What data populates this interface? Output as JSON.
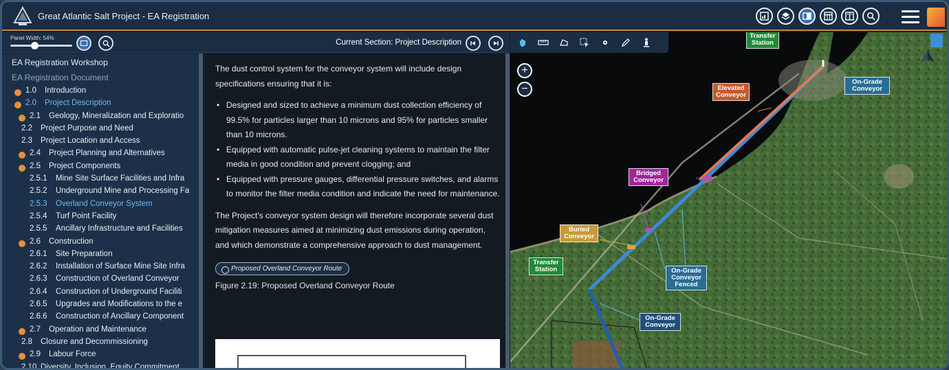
{
  "app": {
    "title": "Great Atlantic Salt Project - EA Registration"
  },
  "toolbar_icons": [
    "chart-icon",
    "layers-icon",
    "document-icon",
    "table-icon",
    "book-icon",
    "search-icon"
  ],
  "left_toolbar": {
    "panel_width_label": "Panel Width: 54%",
    "panel_width_percent": 54,
    "current_section": "Current Section: Project Description"
  },
  "toc": {
    "heading": "EA Registration Workshop",
    "subheading": "EA Registration Document",
    "items": [
      {
        "num": "1.0",
        "label": "Introduction",
        "level": 0,
        "bullet": true
      },
      {
        "num": "2.0",
        "label": "Project Description",
        "level": 0,
        "bullet": true,
        "active": true
      },
      {
        "num": "2.1",
        "label": "Geology, Mineralization and Exploratio",
        "level": 1,
        "bullet": true
      },
      {
        "num": "2.2",
        "label": "Project Purpose and Need",
        "level": 1
      },
      {
        "num": "2.3",
        "label": "Project Location and Access",
        "level": 1
      },
      {
        "num": "2.4",
        "label": "Project Planning and Alternatives",
        "level": 1,
        "bullet": true
      },
      {
        "num": "2.5",
        "label": "Project Components",
        "level": 1,
        "bullet": true
      },
      {
        "num": "2.5.1",
        "label": "Mine Site Surface Facilities and Infra",
        "level": 2
      },
      {
        "num": "2.5.2",
        "label": "Underground Mine and Processing Fa",
        "level": 2
      },
      {
        "num": "2.5.3",
        "label": "Overland Conveyor System",
        "level": 2,
        "active": true
      },
      {
        "num": "2.5.4",
        "label": "Turf Point Facility",
        "level": 2
      },
      {
        "num": "2.5.5",
        "label": "Ancillary Infrastructure and Facilities",
        "level": 2
      },
      {
        "num": "2.6",
        "label": "Construction",
        "level": 1,
        "bullet": true
      },
      {
        "num": "2.6.1",
        "label": "Site Preparation",
        "level": 2
      },
      {
        "num": "2.6.2",
        "label": "Installation of Surface Mine Site Infra",
        "level": 2
      },
      {
        "num": "2.6.3",
        "label": "Construction of Overland Conveyor",
        "level": 2
      },
      {
        "num": "2.6.4",
        "label": "Construction of Underground Faciliti",
        "level": 2
      },
      {
        "num": "2.6.5",
        "label": "Upgrades and Modifications to the e",
        "level": 2
      },
      {
        "num": "2.6.6",
        "label": "Construction of Ancillary Component",
        "level": 2
      },
      {
        "num": "2.7",
        "label": "Operation and Maintenance",
        "level": 1,
        "bullet": true
      },
      {
        "num": "2.8",
        "label": "Closure and Decommissioning",
        "level": 1
      },
      {
        "num": "2.9",
        "label": "Labour Force",
        "level": 1,
        "bullet": true
      },
      {
        "num": "2.10",
        "label": "Diversity, Inclusion, Equity Commitment",
        "level": 1
      }
    ]
  },
  "document": {
    "intro": "The dust control system for the conveyor system will include design specifications ensuring that it is:",
    "bullets": [
      "Designed and sized to achieve a minimum dust collection efficiency of 99.5% for particles larger than 10 microns and 95% for particles smaller than 10 microns.",
      "Equipped with automatic pulse-jet cleaning systems to maintain the filter media in good condition and prevent clogging; and",
      "Equipped with pressure gauges, differential pressure switches, and alarms to monitor the filter media condition and indicate the need for maintenance."
    ],
    "conclusion": "The Project's conveyor system design will therefore incorporate several dust mitigation measures aimed at minimizing dust emissions during operation, and which demonstrate a comprehensive approach to dust management.",
    "map_link": "Proposed Overland Conveyor Route",
    "figure_caption": "Figure 2.19: Proposed Overland Conveyor Route"
  },
  "map": {
    "zoom_in": "+",
    "zoom_out": "−",
    "labels": {
      "transfer_top": "Transfer Station",
      "ongrade_top": "On-Grade Conveyor",
      "elevated": "Elevated Conveyor",
      "bridged": "Bridged Conveyor",
      "buried": "Buried Conveyor",
      "transfer_left": "Transfer Station",
      "ongrade_fenced": "On-Grade Conveyor Fenced",
      "ongrade_bottom": "On-Grade Conveyor"
    },
    "colors": {
      "green": "#1f8a3a",
      "orange": "#c45a2c",
      "purple": "#a0279a",
      "tan": "#c99a3a",
      "blue": "#2a6d94",
      "navy": "#1f4e7a"
    }
  }
}
